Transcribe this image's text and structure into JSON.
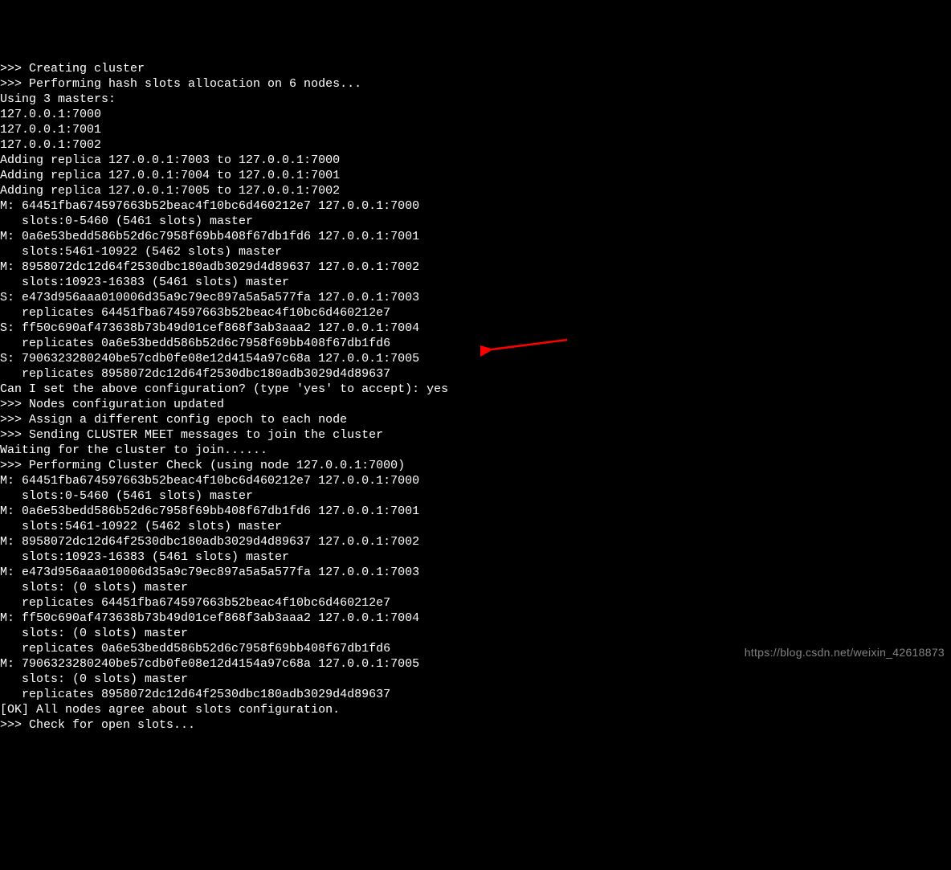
{
  "watermark": "https://blog.csdn.net/weixin_42618873",
  "lines": [
    ">>> Creating cluster",
    ">>> Performing hash slots allocation on 6 nodes...",
    "Using 3 masters:",
    "127.0.0.1:7000",
    "127.0.0.1:7001",
    "127.0.0.1:7002",
    "Adding replica 127.0.0.1:7003 to 127.0.0.1:7000",
    "Adding replica 127.0.0.1:7004 to 127.0.0.1:7001",
    "Adding replica 127.0.0.1:7005 to 127.0.0.1:7002",
    "M: 64451fba674597663b52beac4f10bc6d460212e7 127.0.0.1:7000",
    "   slots:0-5460 (5461 slots) master",
    "M: 0a6e53bedd586b52d6c7958f69bb408f67db1fd6 127.0.0.1:7001",
    "   slots:5461-10922 (5462 slots) master",
    "M: 8958072dc12d64f2530dbc180adb3029d4d89637 127.0.0.1:7002",
    "   slots:10923-16383 (5461 slots) master",
    "S: e473d956aaa010006d35a9c79ec897a5a5a577fa 127.0.0.1:7003",
    "   replicates 64451fba674597663b52beac4f10bc6d460212e7",
    "S: ff50c690af473638b73b49d01cef868f3ab3aaa2 127.0.0.1:7004",
    "   replicates 0a6e53bedd586b52d6c7958f69bb408f67db1fd6",
    "S: 7906323280240be57cdb0fe08e12d4154a97c68a 127.0.0.1:7005",
    "   replicates 8958072dc12d64f2530dbc180adb3029d4d89637",
    "Can I set the above configuration? (type 'yes' to accept): yes",
    ">>> Nodes configuration updated",
    ">>> Assign a different config epoch to each node",
    ">>> Sending CLUSTER MEET messages to join the cluster",
    "Waiting for the cluster to join......",
    ">>> Performing Cluster Check (using node 127.0.0.1:7000)",
    "M: 64451fba674597663b52beac4f10bc6d460212e7 127.0.0.1:7000",
    "   slots:0-5460 (5461 slots) master",
    "M: 0a6e53bedd586b52d6c7958f69bb408f67db1fd6 127.0.0.1:7001",
    "   slots:5461-10922 (5462 slots) master",
    "M: 8958072dc12d64f2530dbc180adb3029d4d89637 127.0.0.1:7002",
    "   slots:10923-16383 (5461 slots) master",
    "M: e473d956aaa010006d35a9c79ec897a5a5a577fa 127.0.0.1:7003",
    "   slots: (0 slots) master",
    "   replicates 64451fba674597663b52beac4f10bc6d460212e7",
    "M: ff50c690af473638b73b49d01cef868f3ab3aaa2 127.0.0.1:7004",
    "   slots: (0 slots) master",
    "   replicates 0a6e53bedd586b52d6c7958f69bb408f67db1fd6",
    "M: 7906323280240be57cdb0fe08e12d4154a97c68a 127.0.0.1:7005",
    "   slots: (0 slots) master",
    "   replicates 8958072dc12d64f2530dbc180adb3029d4d89637",
    "[OK] All nodes agree about slots configuration.",
    ">>> Check for open slots..."
  ]
}
